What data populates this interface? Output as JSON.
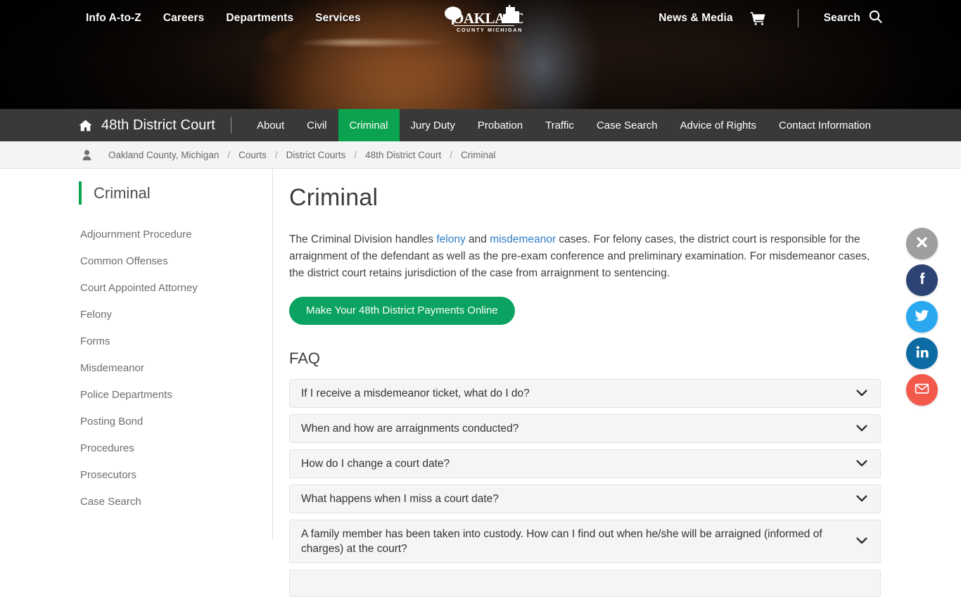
{
  "topnav": {
    "left_links": [
      "Info A-to-Z",
      "Careers",
      "Departments",
      "Services"
    ],
    "news_media": "News & Media",
    "search_label": "Search",
    "cart_icon": "shopping-cart-icon",
    "search_icon": "search-icon"
  },
  "logo": {
    "name": "OAKLAND",
    "subtitle": "COUNTY MICHIGAN"
  },
  "secnav": {
    "home_icon": "home-icon",
    "brand": "48th District Court",
    "items": [
      {
        "label": "About",
        "active": false
      },
      {
        "label": "Civil",
        "active": false
      },
      {
        "label": "Criminal",
        "active": true
      },
      {
        "label": "Jury Duty",
        "active": false
      },
      {
        "label": "Probation",
        "active": false
      },
      {
        "label": "Traffic",
        "active": false
      },
      {
        "label": "Case Search",
        "active": false
      },
      {
        "label": "Advice of Rights",
        "active": false
      },
      {
        "label": "Contact Information",
        "active": false
      }
    ],
    "active_color": "#0ba350"
  },
  "breadcrumb": {
    "user_icon": "user-icon",
    "separator": "/",
    "items": [
      "Oakland County, Michigan",
      "Courts",
      "District Courts",
      "48th District Court",
      "Criminal"
    ]
  },
  "sidebar": {
    "heading": "Criminal",
    "accent_color": "#0ba350",
    "items": [
      "Adjournment Procedure",
      "Common Offenses",
      "Court Appointed Attorney",
      "Felony",
      "Forms",
      "Misdemeanor",
      "Police Departments",
      "Posting Bond",
      "Procedures",
      "Prosecutors",
      "Case Search"
    ]
  },
  "main": {
    "title": "Criminal",
    "intro": {
      "p1": "The Criminal Division handles ",
      "link1": "felony",
      "p2": " and ",
      "link2": "misdemeanor",
      "p3": " cases. For felony cases, the district court is responsible for the arraignment of the defendant as well as the pre-exam conference and preliminary examination. For misdemeanor cases, the district court retains jurisdiction of the case from arraignment to sentencing.",
      "link_color": "#2f7ec4"
    },
    "cta_label": "Make Your 48th District Payments Online",
    "cta_color": "#0ba361",
    "faq_heading": "FAQ",
    "faqs": [
      "If I receive a misdemeanor ticket, what do I do?",
      "When and how are arraignments conducted?",
      "How do I change a court date?",
      "What happens when I miss a court date?",
      "A family member has been taken into custody. How can I find out when he/she will be arraigned (informed of charges) at the court?",
      ""
    ],
    "chevron_icon": "chevron-down-icon"
  },
  "social": {
    "buttons": [
      {
        "name": "close-share-button",
        "icon": "close-icon",
        "color": "#9e9e9e"
      },
      {
        "name": "facebook-share-button",
        "icon": "facebook-icon",
        "color": "#2d4373"
      },
      {
        "name": "twitter-share-button",
        "icon": "twitter-icon",
        "color": "#29a8f0"
      },
      {
        "name": "linkedin-share-button",
        "icon": "linkedin-icon",
        "color": "#0d6ba4"
      },
      {
        "name": "email-share-button",
        "icon": "email-icon",
        "color": "#f2594b"
      }
    ]
  }
}
